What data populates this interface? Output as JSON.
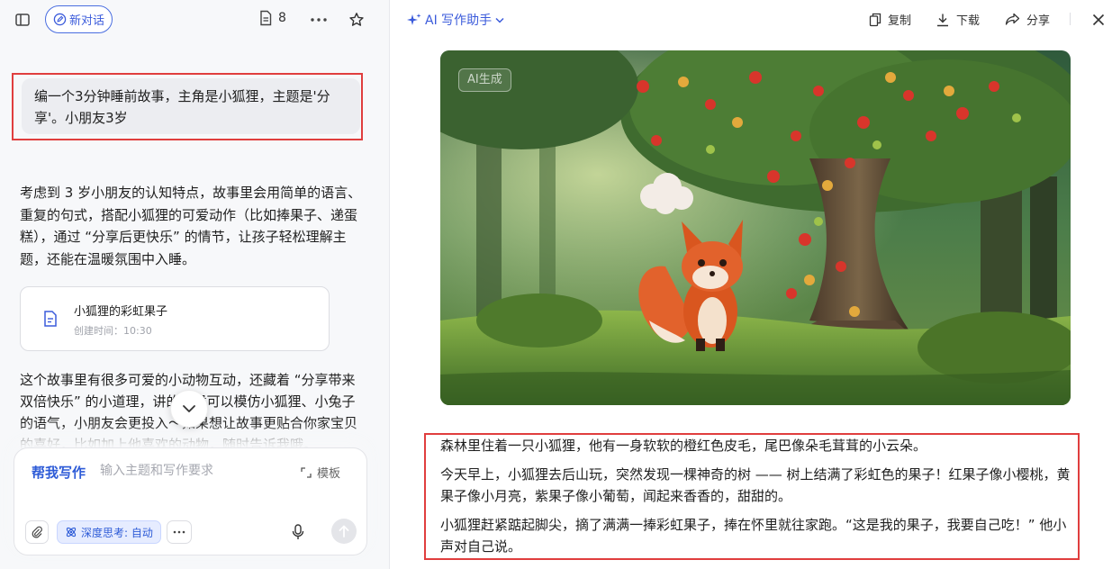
{
  "left_header": {
    "new_chat_label": "新对话",
    "doc_count": "8"
  },
  "user_message": "编一个3分钟睡前故事，主角是小狐狸，主题是'分享'。小朋友3岁",
  "answer_intro": "考虑到 3 岁小朋友的认知特点，故事里会用简单的语言、重复的句式，搭配小狐狸的可爱动作（比如捧果子、递蛋糕），通过 “分享后更快乐” 的情节，让孩子轻松理解主题，还能在温暖氛围中入睡。",
  "doc_card": {
    "title": "小狐狸的彩虹果子",
    "created": "创建时间：10:30"
  },
  "answer_outro": "这个故事里有很多可爱的小动物互动，还藏着 “分享带来双倍快乐” 的小道理，讲的时候可以模仿小狐狸、小兔子的语气，小朋友会更投入～如果想让故事更贴合你家宝贝的喜好，比如加上他喜欢的动物，随时告诉我哦。",
  "composer": {
    "mode_label": "帮我写作",
    "placeholder": "输入主题和写作要求",
    "template_label": "模板",
    "deep_think_label": "深度思考: 自动"
  },
  "right_header": {
    "assistant_label": "AI 写作助手",
    "copy_label": "复制",
    "download_label": "下载",
    "share_label": "分享"
  },
  "image": {
    "badge": "AI生成"
  },
  "story": {
    "p1": "森林里住着一只小狐狸，他有一身软软的橙红色皮毛，尾巴像朵毛茸茸的小云朵。",
    "p2": "今天早上，小狐狸去后山玩，突然发现一棵神奇的树 —— 树上结满了彩虹色的果子！红果子像小樱桃，黄果子像小月亮，紫果子像小葡萄，闻起来香香的，甜甜的。",
    "p3": "小狐狸赶紧踮起脚尖，摘了满满一捧彩虹果子，捧在怀里就往家跑。“这是我的果子，我要自己吃！” 他小声对自己说。"
  },
  "colors": {
    "accent": "#3b5bdb",
    "highlight_frame": "#e03e3e"
  }
}
